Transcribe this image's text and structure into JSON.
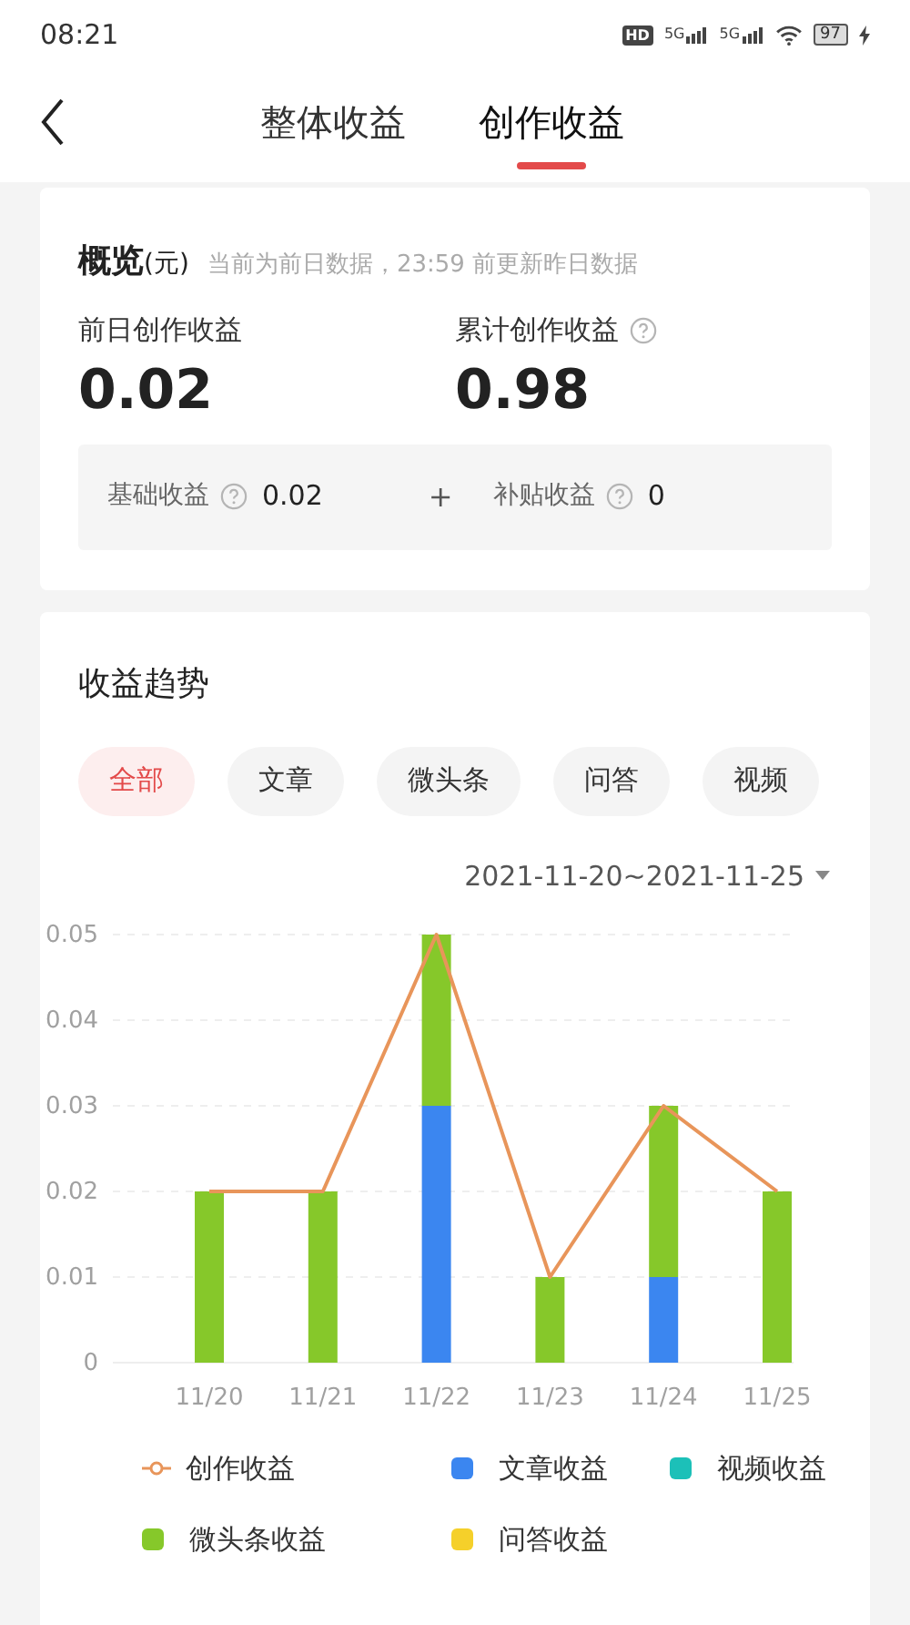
{
  "status_bar": {
    "time": "08:21",
    "hd": "HD",
    "networks": [
      "5G",
      "5G"
    ],
    "battery": "97"
  },
  "header": {
    "tabs": [
      {
        "label": "整体收益",
        "selected": false
      },
      {
        "label": "创作收益",
        "selected": true
      }
    ]
  },
  "overview": {
    "title": "概览",
    "unit": "(元)",
    "note": "当前为前日数据，23:59 前更新昨日数据",
    "stats": [
      {
        "label": "前日创作收益",
        "value": "0.02",
        "help": false
      },
      {
        "label": "累计创作收益",
        "value": "0.98",
        "help": true
      }
    ],
    "breakdown": [
      {
        "label": "基础收益",
        "help": true,
        "value": "0.02"
      },
      {
        "label": "补贴收益",
        "help": true,
        "value": "0"
      }
    ],
    "operator": "+"
  },
  "trend": {
    "title": "收益趋势",
    "filters": [
      {
        "label": "全部",
        "selected": true
      },
      {
        "label": "文章",
        "selected": false
      },
      {
        "label": "微头条",
        "selected": false
      },
      {
        "label": "问答",
        "selected": false
      },
      {
        "label": "视频",
        "selected": false
      }
    ],
    "date_range": "2021-11-20~2021-11-25",
    "chart_data": {
      "type": "bar",
      "stacked": true,
      "categories": [
        "11/20",
        "11/21",
        "11/22",
        "11/23",
        "11/24",
        "11/25"
      ],
      "ylim": [
        0,
        0.05
      ],
      "grid": true,
      "yticks": [
        0,
        0.01,
        0.02,
        0.03,
        0.04,
        0.05
      ],
      "series": [
        {
          "name": "创作收益",
          "type": "line",
          "color": "#e8955a",
          "values": [
            0.02,
            0.02,
            0.05,
            0.01,
            0.03,
            0.02
          ]
        },
        {
          "name": "文章收益",
          "type": "bar",
          "color": "#3b86f0",
          "values": [
            0,
            0,
            0.03,
            0,
            0.01,
            0
          ]
        },
        {
          "name": "视频收益",
          "type": "bar",
          "color": "#1cc0b8",
          "values": [
            0,
            0,
            0,
            0,
            0,
            0
          ]
        },
        {
          "name": "微头条收益",
          "type": "bar",
          "color": "#86c82a",
          "values": [
            0.02,
            0.02,
            0.02,
            0.01,
            0.02,
            0.02
          ]
        },
        {
          "name": "问答收益",
          "type": "bar",
          "color": "#f5d02a",
          "values": [
            0,
            0,
            0,
            0,
            0,
            0
          ]
        }
      ]
    }
  }
}
